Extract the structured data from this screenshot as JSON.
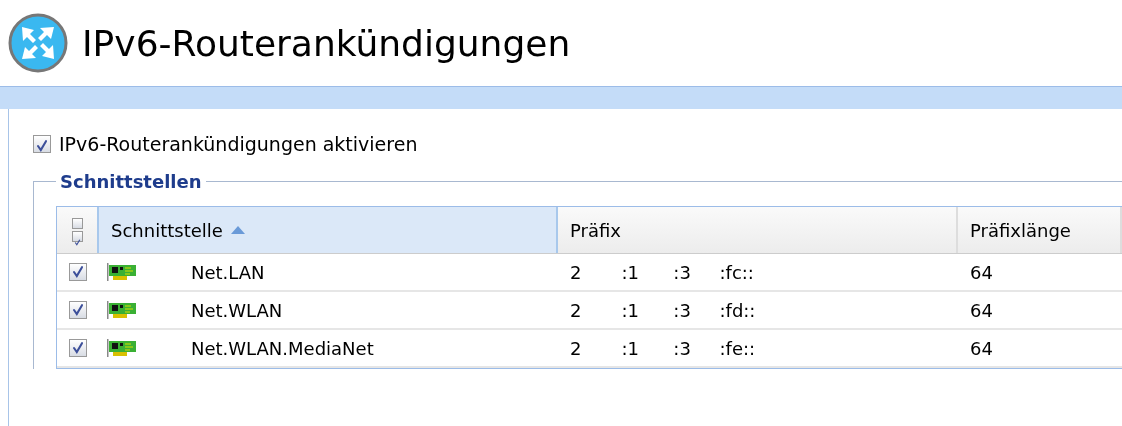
{
  "page": {
    "title": "IPv6-Routerankündigungen"
  },
  "enable": {
    "label": "IPv6-Routerankündigungen aktivieren",
    "checked": true
  },
  "interfaces": {
    "legend": "Schnittstellen",
    "columns": [
      {
        "label": "Schnittstelle",
        "sorted": true
      },
      {
        "label": "Präfix",
        "sorted": false
      },
      {
        "label": "Präfixlänge",
        "sorted": false
      }
    ],
    "rows": [
      {
        "checked": true,
        "name": "Net.LAN",
        "prefix": "2       :1      :3     :fc::",
        "length": "64"
      },
      {
        "checked": true,
        "name": "Net.WLAN",
        "prefix": "2       :1      :3     :fd::",
        "length": "64"
      },
      {
        "checked": true,
        "name": "Net.WLAN.MediaNet",
        "prefix": "2       :1      :3     :fe::",
        "length": "64"
      }
    ]
  }
}
